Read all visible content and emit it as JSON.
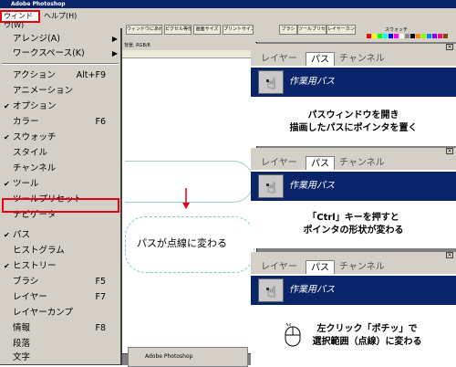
{
  "app": {
    "title": "Adobe Photoshop"
  },
  "menubar": {
    "window_label": "ウィンドウ(W)",
    "help_label": "ヘルプ(H)"
  },
  "toolbar": {
    "buttons": [
      "ウィンドウにあわせる",
      "ピクセル等倍",
      "画面サイズ",
      "プリントサイズ"
    ],
    "tabs": [
      "ブラシ",
      "ツールプリセット",
      "レイヤーカンプ"
    ]
  },
  "swatch_panel": {
    "label": "スウォッチ"
  },
  "document": {
    "title": "背景, RGB/8"
  },
  "taskbar": {
    "label": "Adobe Photoshop"
  },
  "dropdown": {
    "items": [
      {
        "label": "アレンジ(A)",
        "shortcut": "",
        "checked": false,
        "submenu": true
      },
      {
        "label": "ワークスペース(K)",
        "shortcut": "",
        "checked": false,
        "submenu": true
      },
      {
        "label": "アクション",
        "shortcut": "Alt+F9",
        "checked": false,
        "submenu": false
      },
      {
        "label": "アニメーション",
        "shortcut": "",
        "checked": false,
        "submenu": false
      },
      {
        "label": "オプション",
        "shortcut": "",
        "checked": true,
        "submenu": false
      },
      {
        "label": "カラー",
        "shortcut": "F6",
        "checked": false,
        "submenu": false
      },
      {
        "label": "スウォッチ",
        "shortcut": "",
        "checked": true,
        "submenu": false
      },
      {
        "label": "スタイル",
        "shortcut": "",
        "checked": false,
        "submenu": false
      },
      {
        "label": "チャンネル",
        "shortcut": "",
        "checked": false,
        "submenu": false
      },
      {
        "label": "ツール",
        "shortcut": "",
        "checked": true,
        "submenu": false
      },
      {
        "label": "ツールプリセット",
        "shortcut": "",
        "checked": false,
        "submenu": false
      },
      {
        "label": "ナビゲータ",
        "shortcut": "",
        "checked": false,
        "submenu": false
      },
      {
        "label": "パス",
        "shortcut": "",
        "checked": true,
        "submenu": false
      },
      {
        "label": "ヒストグラム",
        "shortcut": "",
        "checked": false,
        "submenu": false
      },
      {
        "label": "ヒストリー",
        "shortcut": "",
        "checked": true,
        "submenu": false
      },
      {
        "label": "ブラシ",
        "shortcut": "F5",
        "checked": false,
        "submenu": false
      },
      {
        "label": "レイヤー",
        "shortcut": "F7",
        "checked": false,
        "submenu": false
      },
      {
        "label": "レイヤーカンプ",
        "shortcut": "",
        "checked": false,
        "submenu": false
      },
      {
        "label": "情報",
        "shortcut": "F8",
        "checked": false,
        "submenu": false
      },
      {
        "label": "段落",
        "shortcut": "",
        "checked": false,
        "submenu": false
      },
      {
        "label": "文字",
        "shortcut": "",
        "checked": false,
        "submenu": false
      }
    ]
  },
  "canvas": {
    "caption": "パスが点線に変わる"
  },
  "panels": [
    {
      "tabs": [
        "レイヤー",
        "パス",
        "チャンネル"
      ],
      "active_tab": 1,
      "path_name": "作業用パス"
    },
    {
      "tabs": [
        "レイヤー",
        "パス",
        "チャンネル"
      ],
      "active_tab": 1,
      "path_name": "作業用パス"
    },
    {
      "tabs": [
        "レイヤー",
        "パス",
        "チャンネル"
      ],
      "active_tab": 1,
      "path_name": "作業用パス"
    }
  ],
  "instructions": [
    {
      "line1": "パスウィンドウを開き",
      "line2": "描画したパスにポインタを置く"
    },
    {
      "line1": "「Ctrl」キーを押すと",
      "line2": "ポインタの形状が変わる"
    },
    {
      "line1": "左クリック「ポチッ」で",
      "line2": "選択範囲（点線）に変わる"
    }
  ],
  "colors": {
    "highlight": "#e60012",
    "panel_selected": "#0a246a",
    "title_bar": "#0a246a",
    "menu_bg": "#d4d0c8"
  }
}
